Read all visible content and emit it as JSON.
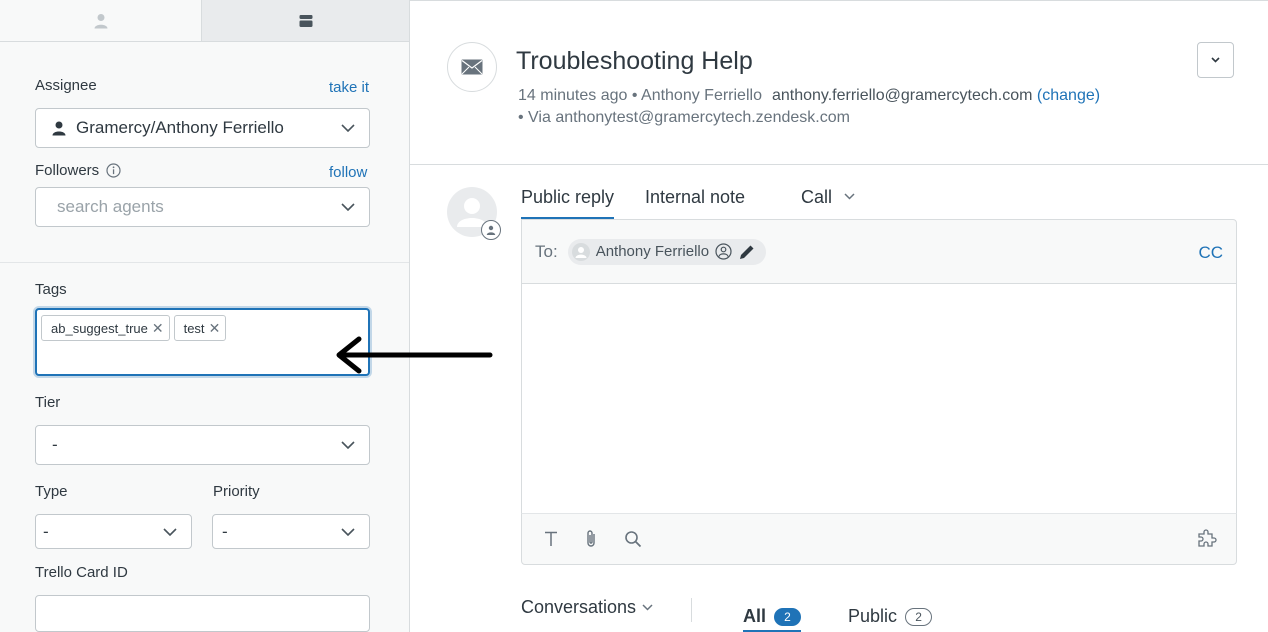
{
  "sidebar": {
    "tabs": [
      {
        "name": "user",
        "icon": "person-icon"
      },
      {
        "name": "ticket",
        "icon": "card-icon"
      }
    ],
    "assignee": {
      "label": "Assignee",
      "action": "take it",
      "value": "Gramercy/Anthony Ferriello"
    },
    "followers": {
      "label": "Followers",
      "action": "follow",
      "placeholder": "search agents"
    },
    "tags": {
      "label": "Tags",
      "items": [
        "ab_suggest_true",
        "test"
      ]
    },
    "tier": {
      "label": "Tier",
      "value": "-"
    },
    "type": {
      "label": "Type",
      "value": "-"
    },
    "priority": {
      "label": "Priority",
      "value": "-"
    },
    "trello": {
      "label": "Trello Card ID",
      "value": ""
    }
  },
  "ticket": {
    "title": "Troubleshooting Help",
    "meta_time": "14 minutes ago • Anthony Ferriello",
    "meta_email": "anthony.ferriello@gramercytech.com",
    "meta_change": "(change)",
    "meta_via": "• Via anthonytest@gramercytech.zendesk.com"
  },
  "composer": {
    "tabs": [
      "Public reply",
      "Internal note",
      "Call"
    ],
    "active_tab": "Public reply",
    "to_label": "To:",
    "recipient": "Anthony Ferriello",
    "cc": "CC"
  },
  "conversations": {
    "label": "Conversations",
    "filters": [
      {
        "label": "All",
        "count": "2"
      },
      {
        "label": "Public",
        "count": "2"
      }
    ]
  },
  "colors": {
    "accent": "#1f73b7",
    "text": "#2f3941",
    "muted": "#68737d",
    "sidebar_bg": "#f8f9f9"
  }
}
